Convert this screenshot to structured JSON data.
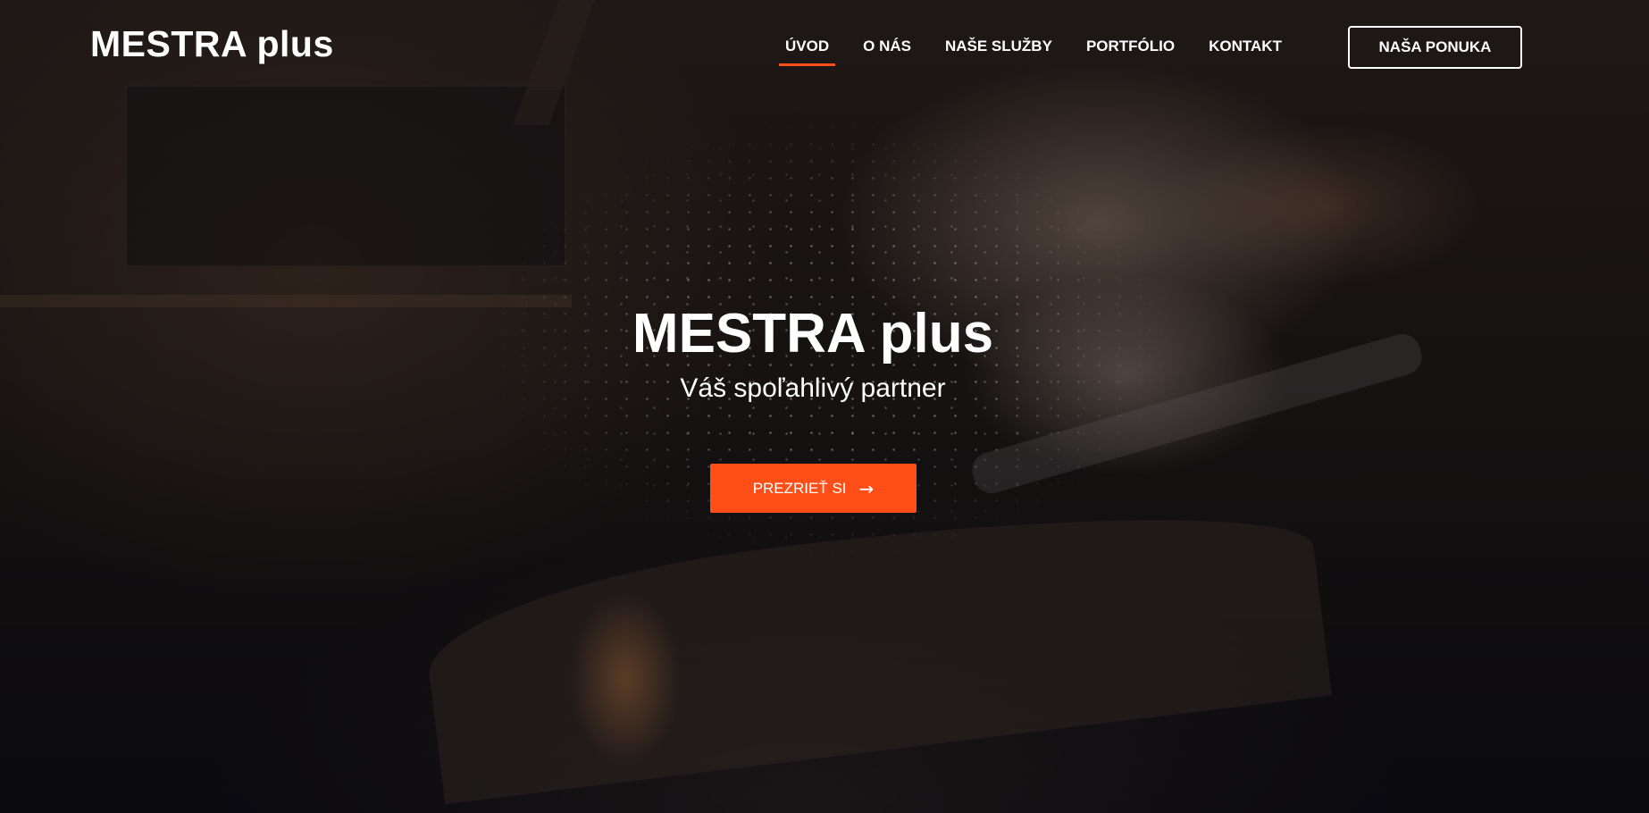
{
  "header": {
    "logo_text": "MESTRA plus",
    "nav": [
      {
        "label": "ÚVOD",
        "active": true
      },
      {
        "label": "O NÁS",
        "active": false
      },
      {
        "label": "NAŠE SLUŽBY",
        "active": false
      },
      {
        "label": "PORTFÓLIO",
        "active": false
      },
      {
        "label": "KONTAKT",
        "active": false
      }
    ],
    "offer_button_label": "NAŠA PONUKA"
  },
  "hero": {
    "title": "MESTRA plus",
    "subtitle": "Váš spoľahlivý partner",
    "cta_label": "PREZRIEŤ SI",
    "cta_arrow": "→"
  },
  "colors": {
    "accent": "#ff4e17",
    "text": "#ffffff",
    "overlay": "#0d0f14"
  }
}
